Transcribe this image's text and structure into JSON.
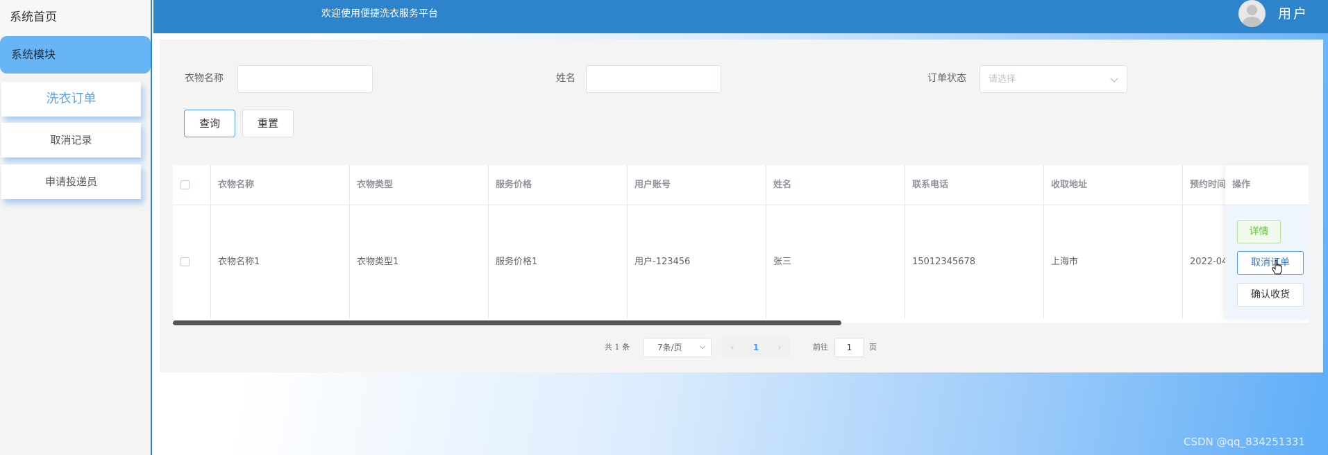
{
  "sidebar": {
    "home": "系统首页",
    "module": "系统模块",
    "items": [
      {
        "label": "洗衣订单"
      },
      {
        "label": "取消记录"
      },
      {
        "label": "申请投递员"
      }
    ]
  },
  "header": {
    "title": "欢迎使用便捷洗衣服务平台",
    "user": "用户"
  },
  "search": {
    "clothes_name_label": "衣物名称",
    "name_label": "姓名",
    "status_label": "订单状态",
    "status_placeholder": "请选择",
    "query_button": "查询",
    "reset_button": "重置"
  },
  "table": {
    "columns": [
      "衣物名称",
      "衣物类型",
      "服务价格",
      "用户账号",
      "姓名",
      "联系电话",
      "收取地址",
      "预约时间",
      "操作"
    ],
    "rows": [
      {
        "clothes_name": "衣物名称1",
        "clothes_type": "衣物类型1",
        "price": "服务价格1",
        "account": "用户-123456",
        "name": "张三",
        "phone": "15012345678",
        "address": "上海市",
        "time": "2022-04-"
      }
    ],
    "actions": {
      "detail": "详情",
      "cancel": "取消订单",
      "confirm": "确认收货"
    }
  },
  "pagination": {
    "total": "共 1 条",
    "page_size": "7条/页",
    "prev": "‹",
    "current": "1",
    "next": "›",
    "goto_label": "前往",
    "goto_value": "1",
    "page_unit": "页"
  },
  "watermark": "CSDN @qq_834251331"
}
